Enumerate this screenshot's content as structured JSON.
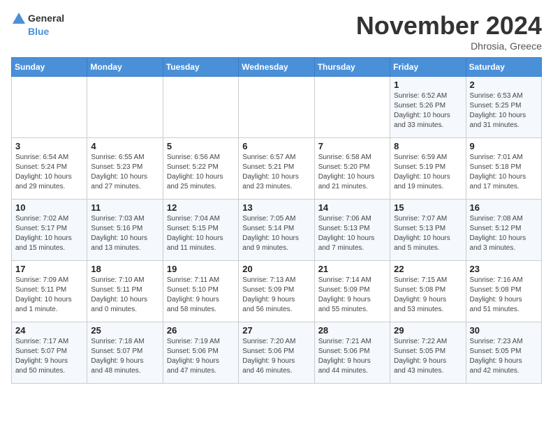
{
  "logo": {
    "general": "General",
    "blue": "Blue"
  },
  "title": "November 2024",
  "location": "Dhrosia, Greece",
  "days_header": [
    "Sunday",
    "Monday",
    "Tuesday",
    "Wednesday",
    "Thursday",
    "Friday",
    "Saturday"
  ],
  "weeks": [
    [
      {
        "day": "",
        "info": ""
      },
      {
        "day": "",
        "info": ""
      },
      {
        "day": "",
        "info": ""
      },
      {
        "day": "",
        "info": ""
      },
      {
        "day": "",
        "info": ""
      },
      {
        "day": "1",
        "info": "Sunrise: 6:52 AM\nSunset: 5:26 PM\nDaylight: 10 hours\nand 33 minutes."
      },
      {
        "day": "2",
        "info": "Sunrise: 6:53 AM\nSunset: 5:25 PM\nDaylight: 10 hours\nand 31 minutes."
      }
    ],
    [
      {
        "day": "3",
        "info": "Sunrise: 6:54 AM\nSunset: 5:24 PM\nDaylight: 10 hours\nand 29 minutes."
      },
      {
        "day": "4",
        "info": "Sunrise: 6:55 AM\nSunset: 5:23 PM\nDaylight: 10 hours\nand 27 minutes."
      },
      {
        "day": "5",
        "info": "Sunrise: 6:56 AM\nSunset: 5:22 PM\nDaylight: 10 hours\nand 25 minutes."
      },
      {
        "day": "6",
        "info": "Sunrise: 6:57 AM\nSunset: 5:21 PM\nDaylight: 10 hours\nand 23 minutes."
      },
      {
        "day": "7",
        "info": "Sunrise: 6:58 AM\nSunset: 5:20 PM\nDaylight: 10 hours\nand 21 minutes."
      },
      {
        "day": "8",
        "info": "Sunrise: 6:59 AM\nSunset: 5:19 PM\nDaylight: 10 hours\nand 19 minutes."
      },
      {
        "day": "9",
        "info": "Sunrise: 7:01 AM\nSunset: 5:18 PM\nDaylight: 10 hours\nand 17 minutes."
      }
    ],
    [
      {
        "day": "10",
        "info": "Sunrise: 7:02 AM\nSunset: 5:17 PM\nDaylight: 10 hours\nand 15 minutes."
      },
      {
        "day": "11",
        "info": "Sunrise: 7:03 AM\nSunset: 5:16 PM\nDaylight: 10 hours\nand 13 minutes."
      },
      {
        "day": "12",
        "info": "Sunrise: 7:04 AM\nSunset: 5:15 PM\nDaylight: 10 hours\nand 11 minutes."
      },
      {
        "day": "13",
        "info": "Sunrise: 7:05 AM\nSunset: 5:14 PM\nDaylight: 10 hours\nand 9 minutes."
      },
      {
        "day": "14",
        "info": "Sunrise: 7:06 AM\nSunset: 5:13 PM\nDaylight: 10 hours\nand 7 minutes."
      },
      {
        "day": "15",
        "info": "Sunrise: 7:07 AM\nSunset: 5:13 PM\nDaylight: 10 hours\nand 5 minutes."
      },
      {
        "day": "16",
        "info": "Sunrise: 7:08 AM\nSunset: 5:12 PM\nDaylight: 10 hours\nand 3 minutes."
      }
    ],
    [
      {
        "day": "17",
        "info": "Sunrise: 7:09 AM\nSunset: 5:11 PM\nDaylight: 10 hours\nand 1 minute."
      },
      {
        "day": "18",
        "info": "Sunrise: 7:10 AM\nSunset: 5:11 PM\nDaylight: 10 hours\nand 0 minutes."
      },
      {
        "day": "19",
        "info": "Sunrise: 7:11 AM\nSunset: 5:10 PM\nDaylight: 9 hours\nand 58 minutes."
      },
      {
        "day": "20",
        "info": "Sunrise: 7:13 AM\nSunset: 5:09 PM\nDaylight: 9 hours\nand 56 minutes."
      },
      {
        "day": "21",
        "info": "Sunrise: 7:14 AM\nSunset: 5:09 PM\nDaylight: 9 hours\nand 55 minutes."
      },
      {
        "day": "22",
        "info": "Sunrise: 7:15 AM\nSunset: 5:08 PM\nDaylight: 9 hours\nand 53 minutes."
      },
      {
        "day": "23",
        "info": "Sunrise: 7:16 AM\nSunset: 5:08 PM\nDaylight: 9 hours\nand 51 minutes."
      }
    ],
    [
      {
        "day": "24",
        "info": "Sunrise: 7:17 AM\nSunset: 5:07 PM\nDaylight: 9 hours\nand 50 minutes."
      },
      {
        "day": "25",
        "info": "Sunrise: 7:18 AM\nSunset: 5:07 PM\nDaylight: 9 hours\nand 48 minutes."
      },
      {
        "day": "26",
        "info": "Sunrise: 7:19 AM\nSunset: 5:06 PM\nDaylight: 9 hours\nand 47 minutes."
      },
      {
        "day": "27",
        "info": "Sunrise: 7:20 AM\nSunset: 5:06 PM\nDaylight: 9 hours\nand 46 minutes."
      },
      {
        "day": "28",
        "info": "Sunrise: 7:21 AM\nSunset: 5:06 PM\nDaylight: 9 hours\nand 44 minutes."
      },
      {
        "day": "29",
        "info": "Sunrise: 7:22 AM\nSunset: 5:05 PM\nDaylight: 9 hours\nand 43 minutes."
      },
      {
        "day": "30",
        "info": "Sunrise: 7:23 AM\nSunset: 5:05 PM\nDaylight: 9 hours\nand 42 minutes."
      }
    ]
  ]
}
